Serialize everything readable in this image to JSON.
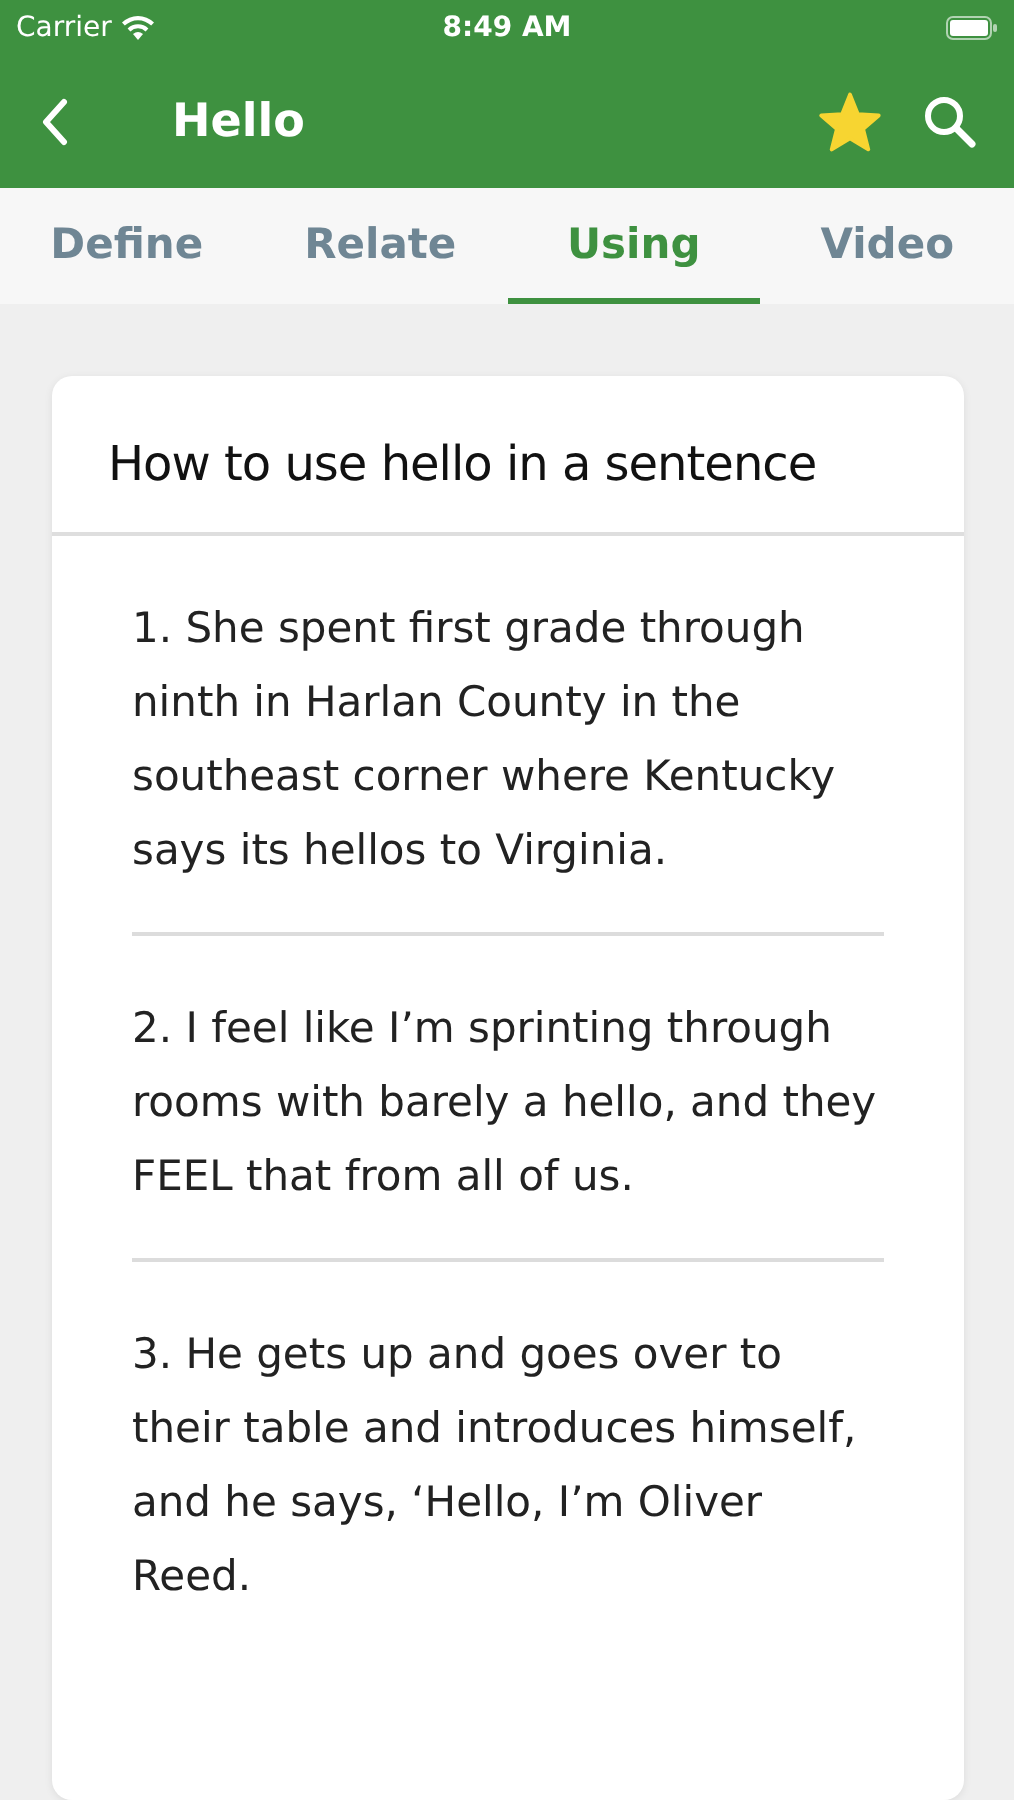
{
  "status_bar": {
    "carrier": "Carrier",
    "time": "8:49 AM"
  },
  "nav": {
    "title": "Hello",
    "starred": true
  },
  "tabs": [
    {
      "label": "Define",
      "selected": false
    },
    {
      "label": "Relate",
      "selected": false
    },
    {
      "label": "Using",
      "selected": true
    },
    {
      "label": "Video",
      "selected": false
    }
  ],
  "card": {
    "title": "How to use hello in a sentence",
    "sentences": [
      "1. She spent first grade through ninth in Harlan County in the southeast corner where Kentucky says its hellos to Virginia.",
      "2. I feel like I’m sprinting through rooms with barely a hello, and they FEEL that from all of us.",
      "3. He gets up and goes over to their table and introduces himself, and he says, ‘Hello, I’m Oliver Reed."
    ]
  }
}
